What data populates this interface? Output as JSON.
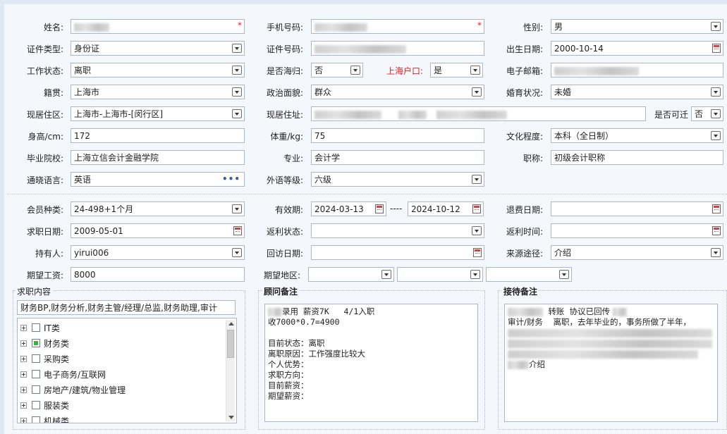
{
  "form": {
    "name": {
      "label": "姓名:",
      "required_mark": "*"
    },
    "phone": {
      "label": "手机号码:",
      "required_mark": "*"
    },
    "gender": {
      "label": "性别:",
      "value": "男"
    },
    "id_type": {
      "label": "证件类型:",
      "value": "身份证"
    },
    "id_number": {
      "label": "证件号码:"
    },
    "birth_date": {
      "label": "出生日期:",
      "value": "2000-10-14"
    },
    "work_status": {
      "label": "工作状态:",
      "value": "离职"
    },
    "returnee": {
      "label": "是否海归:",
      "value": "否"
    },
    "shanghai_hukou": {
      "label": "上海户口:",
      "value": "是"
    },
    "email": {
      "label": "电子邮箱:"
    },
    "native_place": {
      "label": "籍贯:",
      "value": "上海市"
    },
    "political": {
      "label": "政治面貌:",
      "value": "群众"
    },
    "marital": {
      "label": "婚育状况:",
      "value": "未婚"
    },
    "current_area": {
      "label": "现居住区:",
      "value": "上海市-上海市-[闵行区]"
    },
    "current_address": {
      "label": "现居住址:"
    },
    "relocatable": {
      "label": "是否可迁",
      "value": "否"
    },
    "height": {
      "label": "身高/cm:",
      "value": "172"
    },
    "weight": {
      "label": "体重/kg:",
      "value": "75"
    },
    "education": {
      "label": "文化程度:",
      "value": "本科（全日制）"
    },
    "school": {
      "label": "毕业院校:",
      "value": "上海立信会计金融学院"
    },
    "major": {
      "label": "专业:",
      "value": "会计学"
    },
    "title": {
      "label": "职称:",
      "value": "初级会计职称"
    },
    "language": {
      "label": "通晓语言:",
      "value": "英语",
      "more": "•••"
    },
    "foreign_level": {
      "label": "外语等级:",
      "value": "六级"
    }
  },
  "membership": {
    "member_type": {
      "label": "会员种类:",
      "value": "24-498+1个月"
    },
    "valid_period": {
      "label": "有效期:",
      "start": "2024-03-13",
      "sep": "----",
      "end": "2024-10-12"
    },
    "refund_date": {
      "label": "退费日期:"
    },
    "job_date": {
      "label": "求职日期:",
      "value": "2009-05-01"
    },
    "rebate_status": {
      "label": "返利状态:"
    },
    "rebate_time": {
      "label": "返利时间:"
    },
    "holder": {
      "label": "持有人:",
      "value": "yirui006"
    },
    "visit_date": {
      "label": "回访日期:"
    },
    "source": {
      "label": "来源途径:",
      "value": "介绍"
    },
    "expected_salary": {
      "label": "期望工资:",
      "value": "8000"
    },
    "expected_area": {
      "label": "期望地区:"
    }
  },
  "job_panel": {
    "title": "求职内容",
    "summary": "财务BP,财务分析,财务主管/经理/总监,财务助理,审计",
    "tree": [
      {
        "label": "IT类",
        "checked": false
      },
      {
        "label": "财务类",
        "checked": true
      },
      {
        "label": "采购类",
        "checked": false
      },
      {
        "label": "电子商务/互联网",
        "checked": false
      },
      {
        "label": "房地产/建筑/物业管理",
        "checked": false
      },
      {
        "label": "服装类",
        "checked": false
      },
      {
        "label": "机械类",
        "checked": false
      }
    ]
  },
  "advisor_panel": {
    "title": "顾问备注",
    "lines": [
      "录用 薪资7K   4/1入职",
      "收7000*0.7=4900",
      "",
      "目前状态：离职",
      "离职原因：工作强度比较大",
      "个人优势：",
      "求职方向：",
      "目前薪资：",
      "期望薪资："
    ]
  },
  "reception_panel": {
    "title": "接待备注",
    "line1": "转账  协议已回传",
    "line2": "审计/财务    离职，去年毕业的，事务所做了半年，",
    "line3": "介绍"
  }
}
